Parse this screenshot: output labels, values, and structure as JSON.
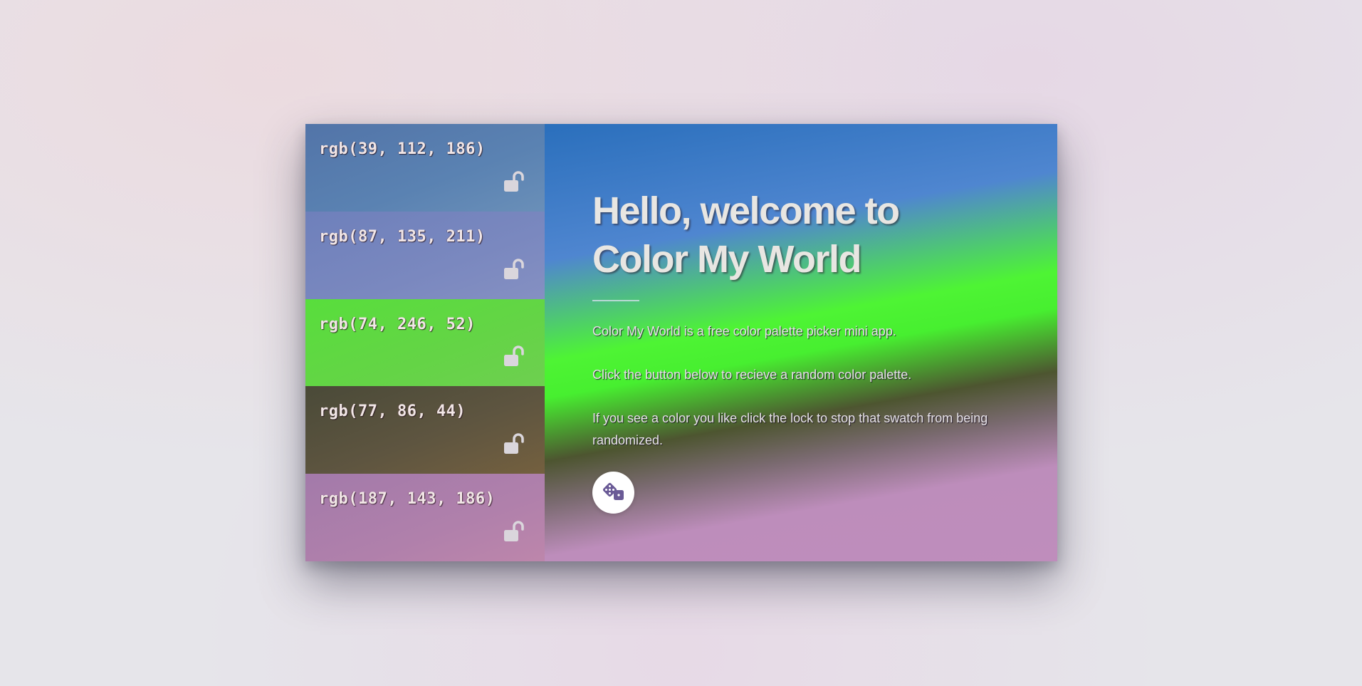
{
  "swatches": [
    {
      "label": "rgb(39, 112, 186)",
      "color": "#2770ba",
      "locked": false
    },
    {
      "label": "rgb(87, 135, 211)",
      "color": "#5787d3",
      "locked": false
    },
    {
      "label": "rgb(74, 246, 52)",
      "color": "#4af634",
      "locked": false
    },
    {
      "label": "rgb(77, 86, 44)",
      "color": "#4d562c",
      "locked": false
    },
    {
      "label": "rgb(187, 143, 186)",
      "color": "#bb8fba",
      "locked": false
    }
  ],
  "main": {
    "title_line1": "Hello, welcome to",
    "title_line2": "Color My World",
    "paragraph1": "Color My World is a free color palette picker mini app.",
    "paragraph2": "Click the button below to recieve a random color palette.",
    "paragraph3": "If you see a color you like click the lock to stop that swatch from being randomized.",
    "randomize_icon": "dice-icon",
    "lock_icon": "unlock-icon"
  }
}
